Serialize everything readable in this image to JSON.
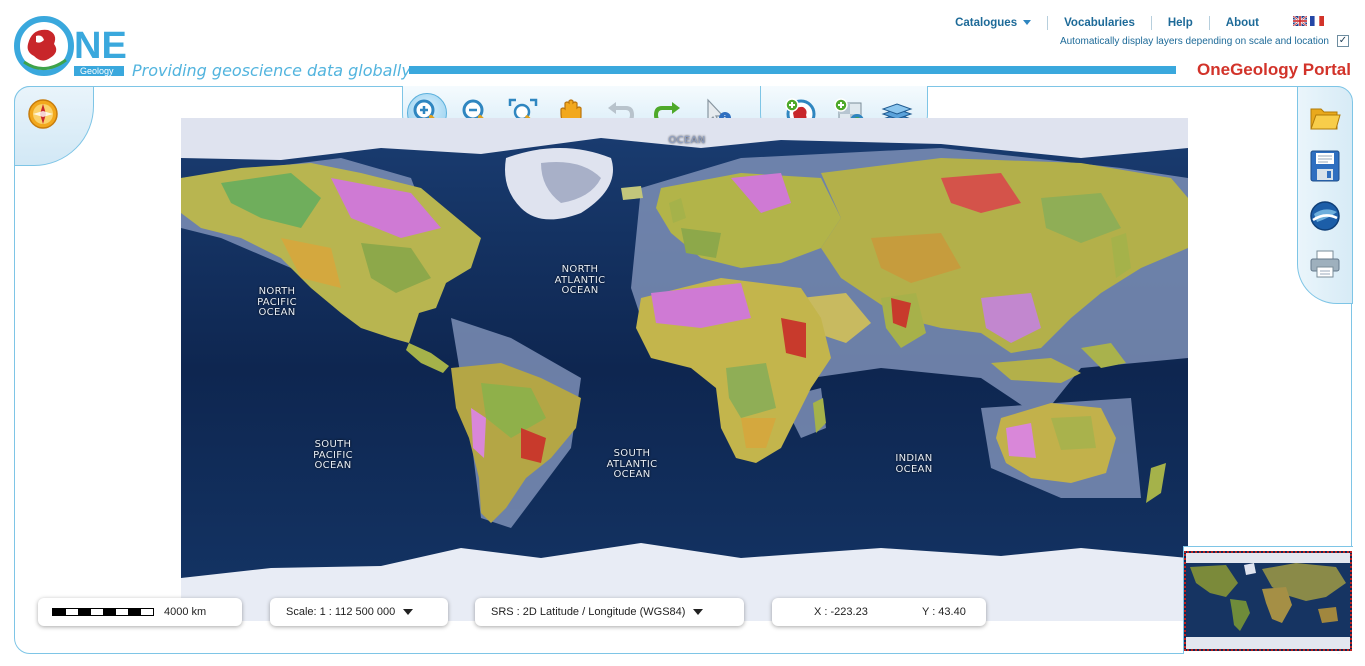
{
  "header": {
    "logo_text": "NE",
    "logo_subtext": "Geology",
    "tagline": "Providing geoscience data globally",
    "portal_title": "OneGeology Portal",
    "nav": [
      {
        "label": "Catalogues",
        "has_dropdown": true
      },
      {
        "label": "Vocabularies"
      },
      {
        "label": "Help"
      },
      {
        "label": "About"
      }
    ],
    "languages": [
      "english-flag-icon",
      "french-flag-icon"
    ],
    "auto_layers_label": "Automatically display layers depending on scale and location",
    "auto_layers_checked": true
  },
  "toolbar": {
    "tools": [
      "zoom-in-icon",
      "zoom-out-icon",
      "zoom-extent-icon",
      "pan-hand-icon",
      "undo-icon",
      "redo-icon",
      "info-pointer-icon"
    ],
    "layer_tools": [
      "add-onegeology-layer-icon",
      "add-wms-layer-icon",
      "layers-stack-icon"
    ],
    "active_tool": "zoom-in-icon"
  },
  "side_tools": [
    "open-folder-icon",
    "save-disk-icon",
    "google-earth-icon",
    "print-icon"
  ],
  "map": {
    "ocean_labels": [
      "NORTH PACIFIC OCEAN",
      "NORTH ATLANTIC OCEAN",
      "SOUTH PACIFIC OCEAN",
      "SOUTH ATLANTIC OCEAN",
      "INDIAN OCEAN"
    ],
    "ocean_lines": [
      [
        "NORTH",
        "PACIFIC",
        "OCEAN"
      ],
      [
        "NORTH",
        "ATLANTIC",
        "OCEAN"
      ],
      [
        "SOUTH",
        "PACIFIC",
        "OCEAN"
      ],
      [
        "SOUTH",
        "ATLANTIC",
        "OCEAN"
      ],
      [
        "INDIAN",
        "OCEAN"
      ]
    ],
    "top_partial_label": "OCEAN"
  },
  "status": {
    "scale_bar_label": "4000 km",
    "scale_label": "Scale: 1 : 112 500 000",
    "srs_label": "SRS : 2D Latitude / Longitude (WGS84)",
    "x_label": "X : -223.23",
    "y_label": "Y : 43.40"
  },
  "colors": {
    "accent_blue": "#3aa8dd",
    "portal_red": "#d2332a",
    "nav_blue": "#1d6a98",
    "ocean": "#0f2a55"
  }
}
